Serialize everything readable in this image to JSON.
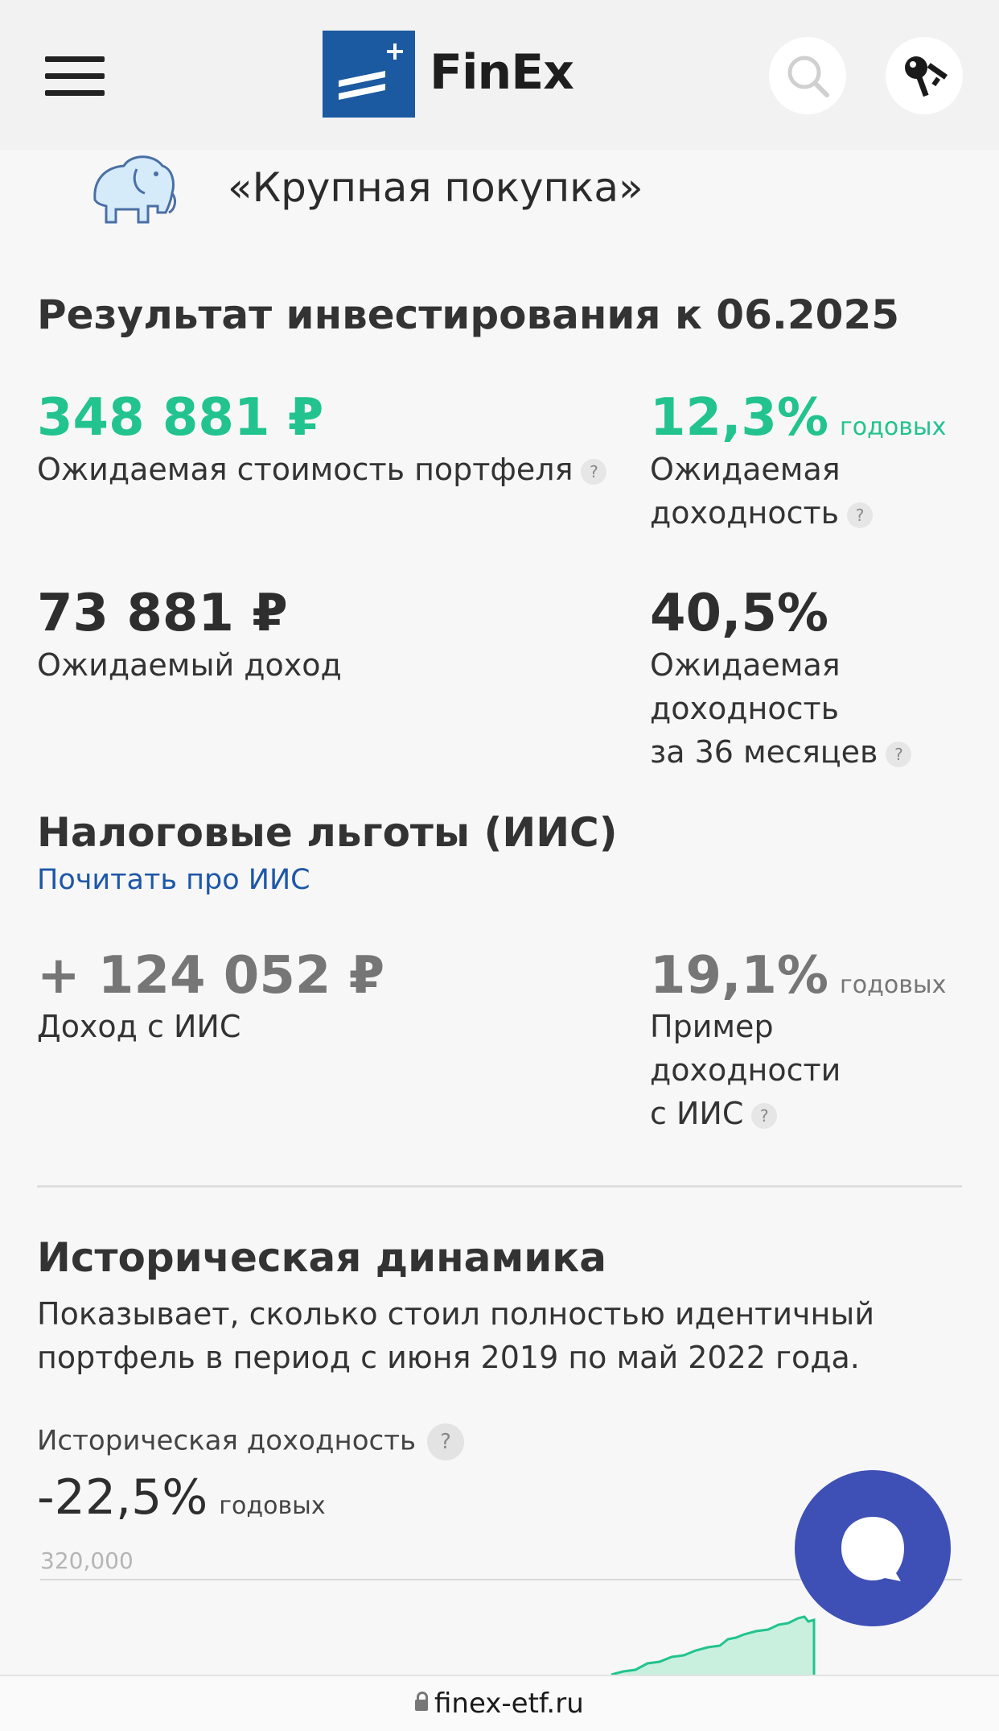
{
  "header": {
    "logo_text": "FinEx",
    "brand_color": "#1b5aa0",
    "icons": [
      "menu-icon",
      "search-icon",
      "key-icon"
    ]
  },
  "portfolio": {
    "icon": "elephant-icon",
    "title": "«Крупная покупка»"
  },
  "result": {
    "heading": "Результат инвестирования к 06.2025",
    "expected_value": "348 881 ₽",
    "expected_value_label": "Ожидаемая стоимость портфеля",
    "expected_yield": "12,3%",
    "expected_yield_unit": "годовых",
    "expected_yield_label_1": "Ожидаемая",
    "expected_yield_label_2": "доходность",
    "expected_income": "73 881 ₽",
    "expected_income_label": "Ожидаемый доход",
    "yield_36": "40,5%",
    "yield_36_label_1": "Ожидаемая",
    "yield_36_label_2": "доходность",
    "yield_36_label_3": "за 36 месяцев",
    "accent_color": "#22c38e"
  },
  "tax": {
    "heading": "Налоговые льготы (ИИС)",
    "link": "Почитать про ИИС",
    "iis_income": "+ 124 052 ₽",
    "iis_income_label": "Доход с ИИС",
    "iis_yield": "19,1%",
    "iis_yield_unit": "годовых",
    "iis_yield_label_1": "Пример",
    "iis_yield_label_2": "доходности",
    "iis_yield_label_3": "с ИИС"
  },
  "history": {
    "heading": "Историческая динамика",
    "description": "Показывает, сколько стоил полностью идентичный портфель в период с июня 2019 по май 2022 года.",
    "yield_label": "Историческая доходность",
    "yield_value": "-22,5%",
    "yield_unit": "годовых",
    "chart_top_tick": "320,000"
  },
  "help_mark": "?",
  "chat": {
    "icon": "chat-bubble-icon",
    "color": "#3e4fb5"
  },
  "browser": {
    "url": "finex-etf.ru"
  }
}
